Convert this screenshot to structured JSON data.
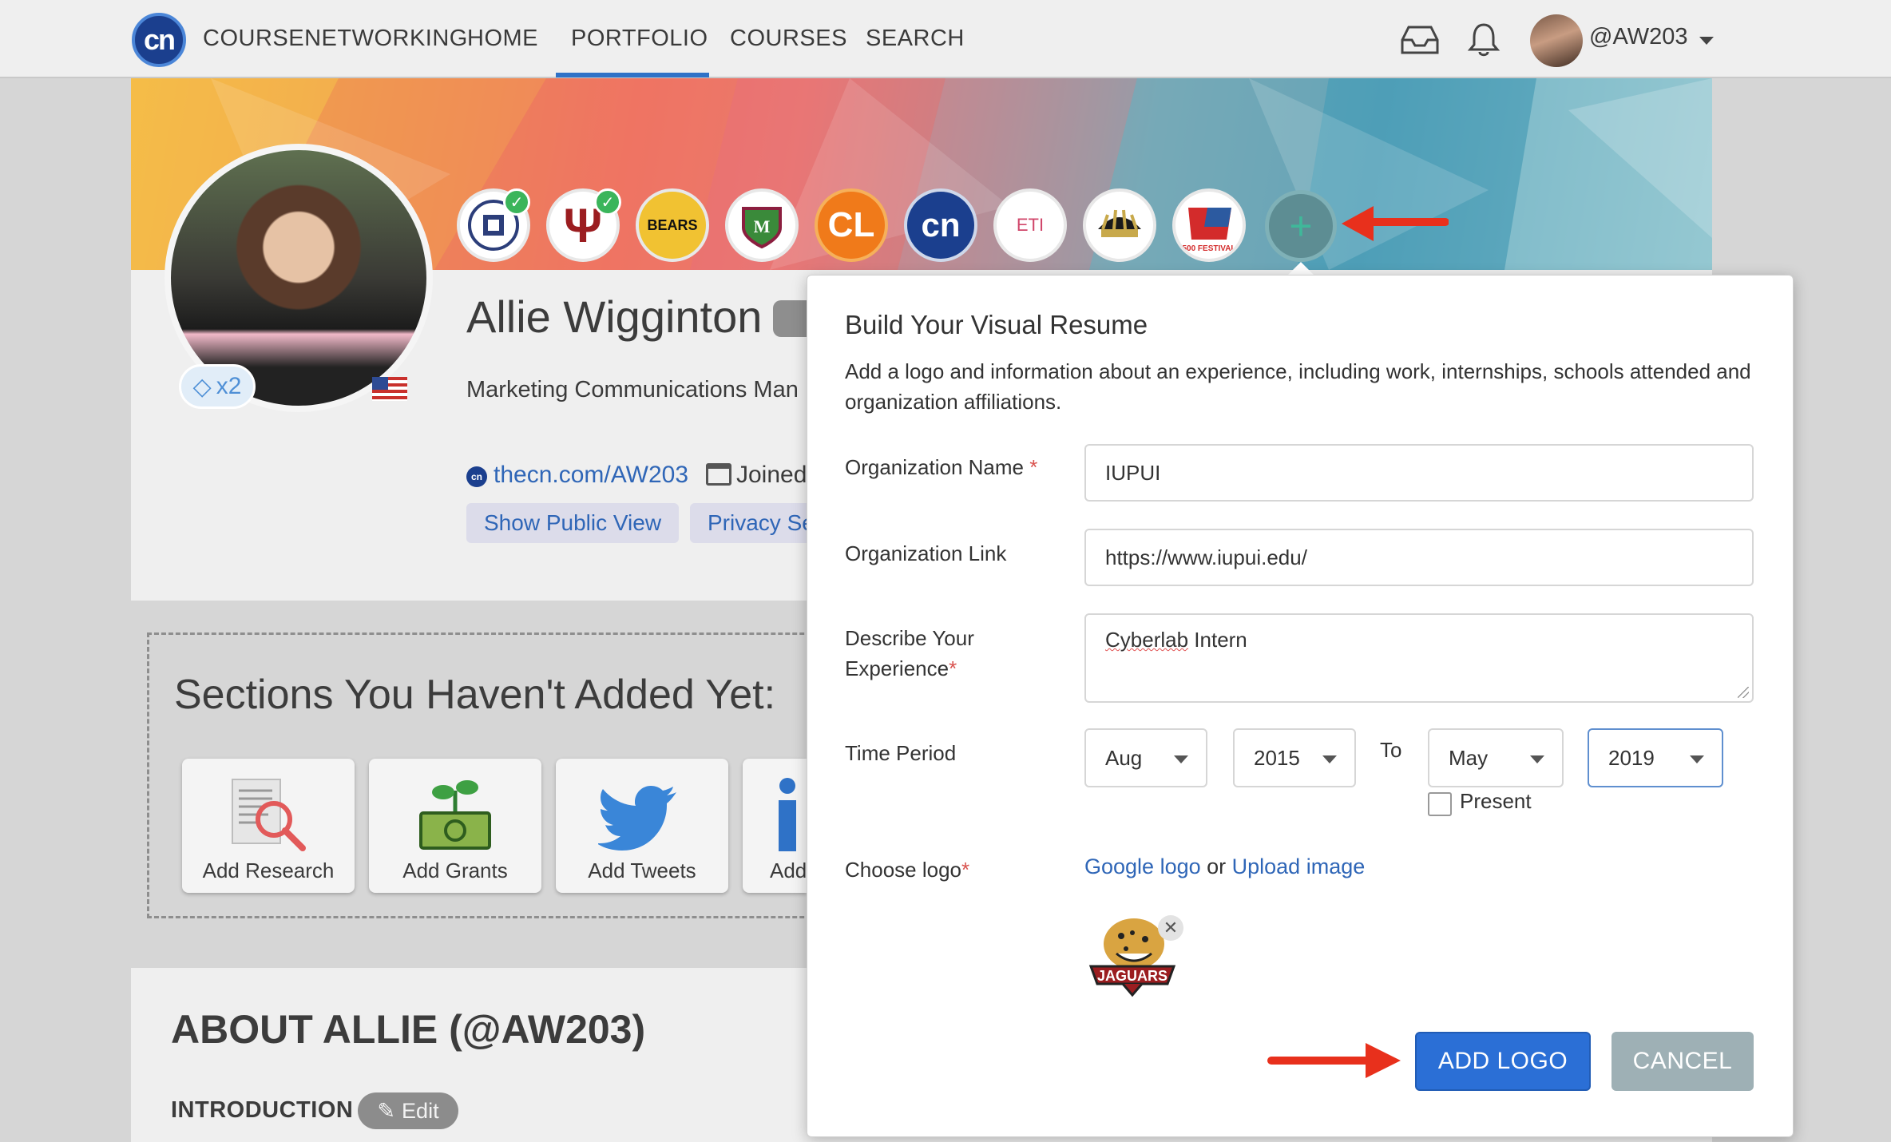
{
  "nav": {
    "brand": "COURSENETWORKING",
    "items": [
      {
        "label": "HOME",
        "active": false
      },
      {
        "label": "PORTFOLIO",
        "active": true
      },
      {
        "label": "COURSES",
        "active": false
      },
      {
        "label": "SEARCH",
        "active": false
      }
    ],
    "logo_text": "cn",
    "user_handle": "@AW203",
    "icons": [
      "inbox-icon",
      "bell-icon",
      "chevron-down-icon"
    ]
  },
  "profile": {
    "name": "Allie Wigginton",
    "title": "Marketing Communications Man",
    "url": "thecn.com/AW203",
    "joined": "Joined",
    "badge": "x2",
    "buttons": {
      "public_view": "Show Public View",
      "privacy": "Privacy Se"
    },
    "org_logos": [
      {
        "name": "university-seal",
        "verified": true
      },
      {
        "name": "indiana-university",
        "text": "Ψ",
        "verified": true
      },
      {
        "name": "bears",
        "text": "BEARS",
        "verified": false
      },
      {
        "name": "school-crest",
        "verified": false
      },
      {
        "name": "cl",
        "text": "CL",
        "verified": false
      },
      {
        "name": "coursenetworking",
        "text": "cn",
        "verified": false
      },
      {
        "name": "eti",
        "text": "ETI",
        "verified": false
      },
      {
        "name": "motor-speedway",
        "verified": false
      },
      {
        "name": "500-festival",
        "text": "500 FESTIVAL",
        "verified": false
      }
    ]
  },
  "sections": {
    "title": "Sections You Haven't Added Yet:",
    "items": [
      {
        "label": "Add Research",
        "icon": "research-icon"
      },
      {
        "label": "Add Grants",
        "icon": "grants-icon"
      },
      {
        "label": "Add Tweets",
        "icon": "twitter-icon"
      },
      {
        "label": "Add",
        "icon": "info-icon"
      }
    ]
  },
  "about": {
    "title": "ABOUT ALLIE (@AW203)",
    "intro": "INTRODUCTION",
    "edit": "Edit"
  },
  "modal": {
    "title": "Build Your Visual Resume",
    "description": "Add a logo and information about an experience, including work, internships, schools attended and organization affiliations.",
    "org_name_label": "Organization Name",
    "org_name_value": "IUPUI",
    "org_link_label": "Organization Link",
    "org_link_value": "https://www.iupui.edu/",
    "describe_label_1": "Describe Your",
    "describe_label_2": "Experience",
    "describe_value_word": "Cyberlab",
    "describe_value_rest": " Intern",
    "time_label": "Time Period",
    "start_month": "Aug",
    "start_year": "2015",
    "to_label": "To",
    "end_month": "May",
    "end_year": "2019",
    "present_label": "Present",
    "present_checked": false,
    "choose_logo_label": "Choose logo",
    "google_logo": "Google logo",
    "or": " or ",
    "upload_image": "Upload image",
    "selected_logo": "JAGUARS",
    "add_button": "ADD LOGO",
    "cancel_button": "CANCEL",
    "required_mark": "*"
  },
  "colors": {
    "primary": "#2b6fd6",
    "link": "#2f66b7",
    "required": "#d9534f",
    "annotation_arrow": "#e8301c",
    "cancel": "#9eb0b5"
  }
}
